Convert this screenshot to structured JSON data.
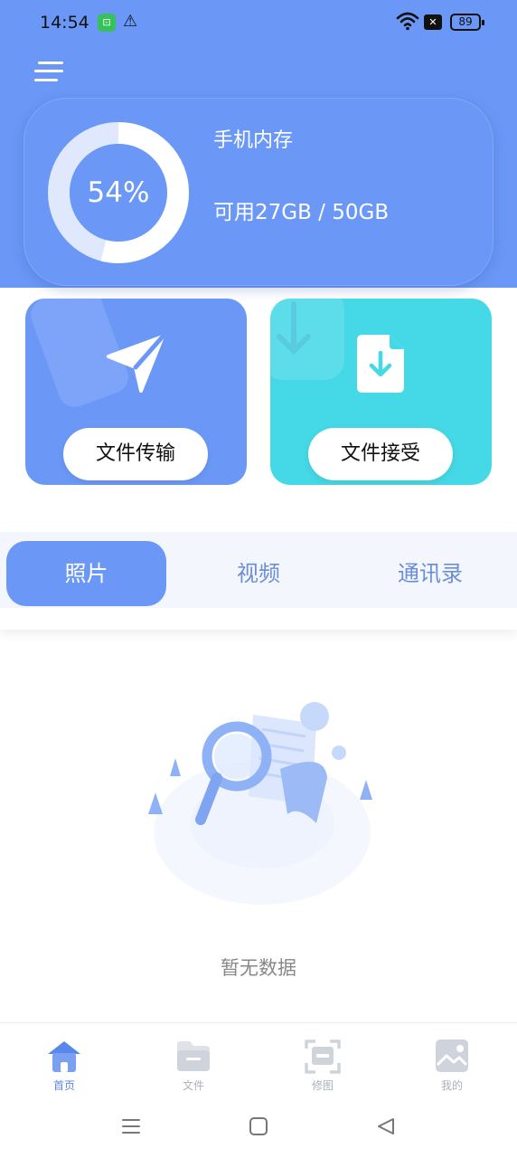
{
  "status_bar": {
    "time": "14:54",
    "battery": "89",
    "icons": [
      "app-notification-icon",
      "warning-icon",
      "wifi-icon",
      "no-sim-icon",
      "battery-icon"
    ]
  },
  "header": {
    "menu_icon": "hamburger-menu-icon"
  },
  "storage": {
    "title": "手机内存",
    "percent_label": "54%",
    "percent_value": 0.54,
    "usage": "可用27GB / 50GB"
  },
  "actions": {
    "send_label": "文件传输",
    "receive_label": "文件接受",
    "send_icon": "paper-plane-icon",
    "receive_icon": "file-download-icon"
  },
  "tabs": [
    {
      "label": "照片",
      "active": true
    },
    {
      "label": "视频",
      "active": false
    },
    {
      "label": "通讯录",
      "active": false
    }
  ],
  "empty_state": {
    "message": "暂无数据",
    "icon": "search-document-illustration"
  },
  "bottom_nav": [
    {
      "label": "首页",
      "icon": "home-icon",
      "active": true
    },
    {
      "label": "文件",
      "icon": "folder-icon",
      "active": false
    },
    {
      "label": "修图",
      "icon": "scan-edit-icon",
      "active": false
    },
    {
      "label": "我的",
      "icon": "image-icon",
      "active": false
    }
  ],
  "colors": {
    "primary": "#6b98f7",
    "cyan": "#45d8e6",
    "tab_bg": "#f3f6fd",
    "nav_active": "#5a87ec",
    "nav_inactive": "#c8ccd4"
  }
}
